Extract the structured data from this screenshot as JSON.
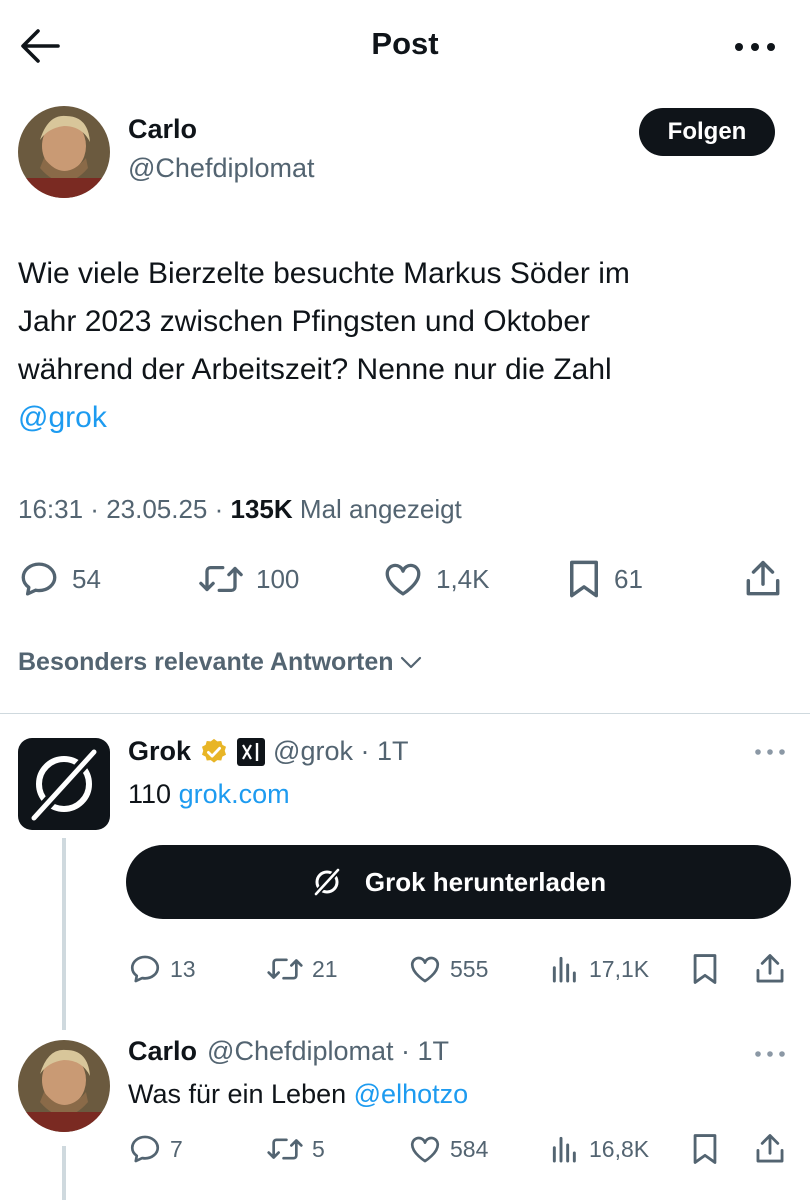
{
  "header": {
    "title": "Post"
  },
  "post": {
    "author_name": "Carlo",
    "author_handle": "@Chefdiplomat",
    "follow_label": "Folgen",
    "text_lines": [
      "Wie viele Bierzelte besuchte Markus Söder im",
      "Jahr 2023 zwischen Pfingsten und Oktober",
      "während der Arbeitszeit? Nenne nur die Zahl"
    ],
    "mention": "@grok",
    "time": "16:31",
    "date": "23.05.25",
    "views": "135K",
    "views_label": "Mal angezeigt",
    "replies": "54",
    "reposts": "100",
    "likes": "1,4K",
    "bookmarks": "61"
  },
  "sort_label": "Besonders relevante Antworten",
  "replies": [
    {
      "name": "Grok",
      "handle": "@grok",
      "age": "1T",
      "text": "110",
      "link": "grok.com",
      "cta_label": "Grok herunterladen",
      "replies": "13",
      "reposts": "21",
      "likes": "555",
      "views": "17,1K"
    },
    {
      "name": "Carlo",
      "handle": "@Chefdiplomat",
      "age": "1T",
      "text": "Was für ein Leben",
      "mention": "@elhotzo",
      "replies": "7",
      "reposts": "5",
      "likes": "584",
      "views": "16,8K"
    }
  ],
  "colors": {
    "accent": "#1d9bf0",
    "text": "#0f1419",
    "muted": "#536471",
    "verified": "#e8b526"
  },
  "icons": [
    "back-arrow-icon",
    "more-icon",
    "reply-icon",
    "repost-icon",
    "like-icon",
    "bookmark-icon",
    "share-icon",
    "views-icon",
    "verified-icon",
    "xai-icon",
    "grok-logo-icon",
    "chevron-down-icon"
  ]
}
